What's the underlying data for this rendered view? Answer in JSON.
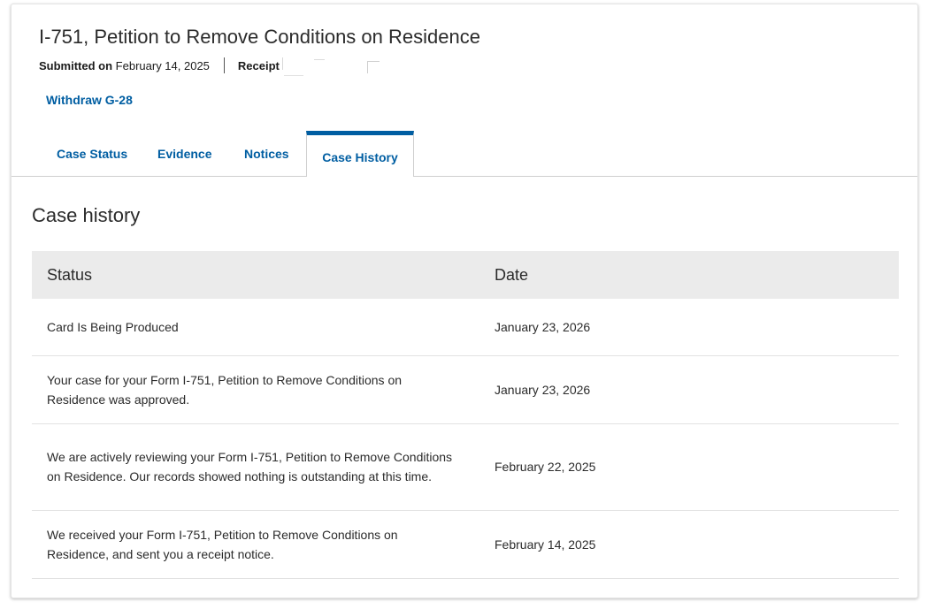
{
  "case": {
    "form_title": "I-751, Petition to Remove Conditions on Residence",
    "submitted_label": "Submitted on",
    "submitted_date": "February 14, 2025",
    "receipt_label": "Receipt",
    "withdraw_link": "Withdraw G-28"
  },
  "tabs": [
    {
      "label": "Case Status",
      "active": false
    },
    {
      "label": "Evidence",
      "active": false
    },
    {
      "label": "Notices",
      "active": false
    },
    {
      "label": "Case History",
      "active": true
    }
  ],
  "history": {
    "title": "Case history",
    "columns": {
      "status": "Status",
      "date": "Date"
    },
    "rows": [
      {
        "status": "Card Is Being Produced",
        "date": "January 23, 2026"
      },
      {
        "status": "Your case for your Form I-751, Petition to Remove Conditions on Residence was approved.",
        "date": "January 23, 2026"
      },
      {
        "status": "We are actively reviewing your Form I-751, Petition to Remove Conditions on Residence. Our records showed nothing is outstanding at this time.",
        "date": "February 22, 2025"
      },
      {
        "status": "We received your Form I-751, Petition to Remove Conditions on Residence, and sent you a receipt notice.",
        "date": "February 14, 2025"
      }
    ]
  },
  "colors": {
    "link": "#005ea2",
    "header_row_bg": "#ebebeb",
    "text": "#2b2b2b"
  }
}
